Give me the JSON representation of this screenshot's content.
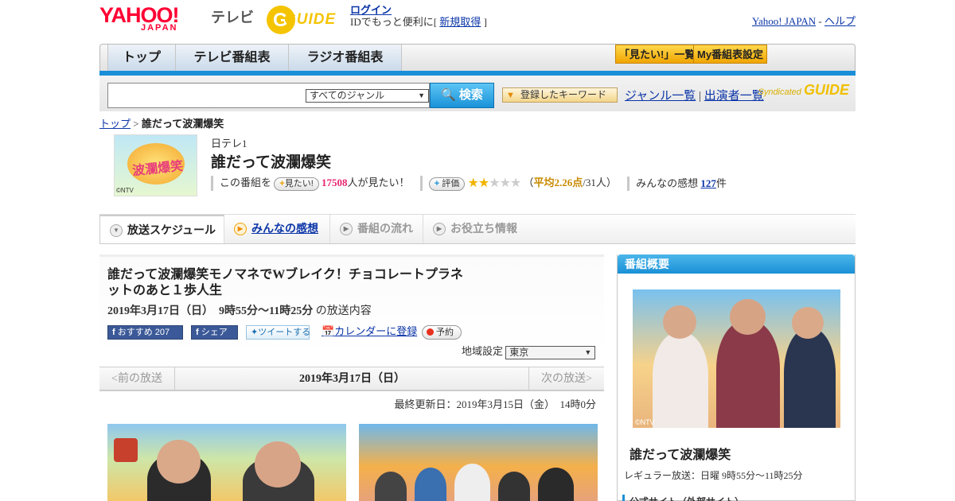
{
  "header": {
    "yahoo_logo": "YAHOO!",
    "yahoo_sub": "JAPAN",
    "tv_label": "テレビ",
    "gguide_text": "GUIDE",
    "login_link": "ログイン",
    "login_prompt": "IDでもっと便利に[",
    "signup_link": "新規取得",
    "login_close": "]",
    "yahoo_japan_link": "Yahoo! JAPAN",
    "separator": "-",
    "help_link": "ヘルプ"
  },
  "nav": {
    "tabs": [
      "トップ",
      "テレビ番組表",
      "ラジオ番組表"
    ],
    "want_list_button": "「見たい!」一覧",
    "my_schedule_button": "My番組表設定"
  },
  "search": {
    "placeholder": "",
    "genre_selected": "すべてのジャンル",
    "search_button": "検索",
    "keyword_button": "登録したキーワード",
    "genre_list_link": "ジャンル一覧",
    "link_separator": "|",
    "performer_list_link": "出演者一覧",
    "syndicated_label": "Syndicated",
    "syndicated_logo": "GUIDE"
  },
  "breadcrumb": {
    "top_link": "トップ",
    "sep": ">",
    "current": "誰だって波瀾爆笑"
  },
  "program": {
    "thumb_title": "波瀾爆笑",
    "thumb_copyright": "©NTV",
    "channel": "日テレ1",
    "title": "誰だって波瀾爆笑",
    "this_program": "この番組を",
    "want_button": "見たい!",
    "want_count": "17508",
    "want_suffix": "人が見たい！",
    "rate_button": "評価",
    "rating": 2,
    "rating_max": 5,
    "avg_open": "（",
    "avg_label": "平均2.26点",
    "avg_people": "/31人）",
    "reviews_label": "みんなの感想",
    "reviews_count": "127",
    "reviews_suffix": "件"
  },
  "tabs": {
    "schedule": "放送スケジュール",
    "reviews": "みんなの感想",
    "flow": "番組の流れ",
    "info": "お役立ち情報"
  },
  "episode": {
    "title_line1": "誰だって波瀾爆笑モノマネでWブレイク！チョコレートプラネ",
    "title_line2": "ットのあと１歩人生",
    "date": "2019年3月17日（日）　9時55分～11時25分",
    "date_suffix": "の放送内容",
    "fb_recommend": "おすすめ 207",
    "fb_share": "シェア",
    "tweet": "ツイートする",
    "calendar": "カレンダーに登録",
    "reserve": "予約",
    "region_label": "地域設定",
    "region_selected": "東京"
  },
  "pager": {
    "prev": "<前の放送",
    "current": "2019年3月17日（日）",
    "next": "次の放送>"
  },
  "updated": "最終更新日：2019年3月15日（金）　14時0分",
  "sidebar": {
    "heading": "番組概要",
    "photo_copyright": "©NTV",
    "title": "誰だって波瀾爆笑",
    "regular": "レギュラー放送：日曜 9時55分～11時25分",
    "official": "公式サイト（外部サイト）"
  }
}
